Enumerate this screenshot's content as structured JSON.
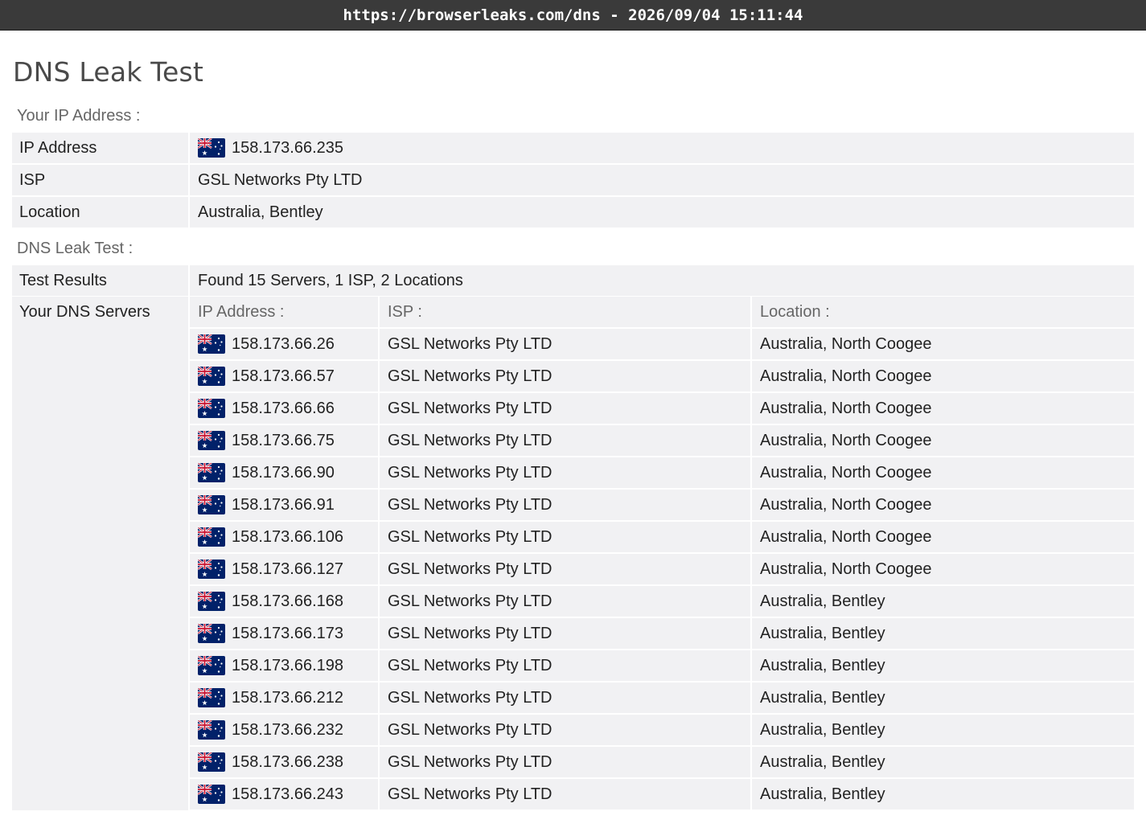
{
  "topbar": {
    "text": "https://browserleaks.com/dns - 2026/09/04 15:11:44"
  },
  "page": {
    "title": "DNS Leak Test"
  },
  "ip_section": {
    "label": "Your IP Address :",
    "rows": [
      {
        "label": "IP Address",
        "value": "158.173.66.235",
        "flag": "australia-flag-icon"
      },
      {
        "label": "ISP",
        "value": "GSL Networks Pty LTD"
      },
      {
        "label": "Location",
        "value": "Australia, Bentley"
      }
    ]
  },
  "dns_section": {
    "label": "DNS Leak Test :",
    "test_results_label": "Test Results",
    "test_results_value": "Found 15 Servers, 1 ISP, 2 Locations",
    "servers_label": "Your DNS Servers",
    "columns": [
      "IP Address :",
      "ISP :",
      "Location :"
    ],
    "servers": [
      {
        "ip": "158.173.66.26",
        "isp": "GSL Networks Pty LTD",
        "location": "Australia, North Coogee"
      },
      {
        "ip": "158.173.66.57",
        "isp": "GSL Networks Pty LTD",
        "location": "Australia, North Coogee"
      },
      {
        "ip": "158.173.66.66",
        "isp": "GSL Networks Pty LTD",
        "location": "Australia, North Coogee"
      },
      {
        "ip": "158.173.66.75",
        "isp": "GSL Networks Pty LTD",
        "location": "Australia, North Coogee"
      },
      {
        "ip": "158.173.66.90",
        "isp": "GSL Networks Pty LTD",
        "location": "Australia, North Coogee"
      },
      {
        "ip": "158.173.66.91",
        "isp": "GSL Networks Pty LTD",
        "location": "Australia, North Coogee"
      },
      {
        "ip": "158.173.66.106",
        "isp": "GSL Networks Pty LTD",
        "location": "Australia, North Coogee"
      },
      {
        "ip": "158.173.66.127",
        "isp": "GSL Networks Pty LTD",
        "location": "Australia, North Coogee"
      },
      {
        "ip": "158.173.66.168",
        "isp": "GSL Networks Pty LTD",
        "location": "Australia, Bentley"
      },
      {
        "ip": "158.173.66.173",
        "isp": "GSL Networks Pty LTD",
        "location": "Australia, Bentley"
      },
      {
        "ip": "158.173.66.198",
        "isp": "GSL Networks Pty LTD",
        "location": "Australia, Bentley"
      },
      {
        "ip": "158.173.66.212",
        "isp": "GSL Networks Pty LTD",
        "location": "Australia, Bentley"
      },
      {
        "ip": "158.173.66.232",
        "isp": "GSL Networks Pty LTD",
        "location": "Australia, Bentley"
      },
      {
        "ip": "158.173.66.238",
        "isp": "GSL Networks Pty LTD",
        "location": "Australia, Bentley"
      },
      {
        "ip": "158.173.66.243",
        "isp": "GSL Networks Pty LTD",
        "location": "Australia, Bentley"
      }
    ]
  },
  "colors": {
    "topbar_bg": "#3a3a3a",
    "row_bg": "#f1f1f3",
    "muted_text": "#666666",
    "flag_blue": "#012169",
    "flag_red": "#c8102e"
  }
}
